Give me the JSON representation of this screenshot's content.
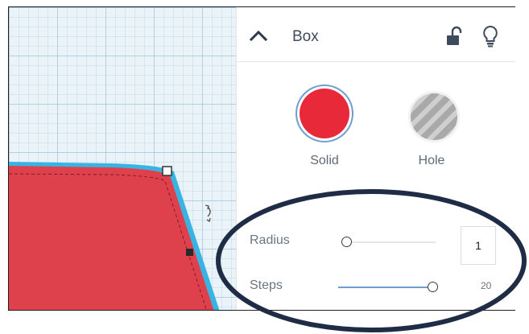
{
  "inspector": {
    "title": "Box",
    "shape_options": {
      "solid_label": "Solid",
      "hole_label": "Hole"
    },
    "params": {
      "radius": {
        "label": "Radius",
        "value": "1",
        "slider_fraction": 0.0
      },
      "steps": {
        "label": "Steps",
        "value": "20",
        "slider_fraction": 1.0
      }
    },
    "icons": {
      "collapse": "chevron-up-icon",
      "lock": "unlock-icon",
      "light": "lightbulb-icon"
    }
  },
  "colors": {
    "solid": "#e8293a",
    "shape_fill": "#df414c",
    "shape_edge": "#3ab6e3",
    "slider_active": "#6e9ed3",
    "annotation": "#1f2c45",
    "title_text": "#3d4b5c"
  }
}
